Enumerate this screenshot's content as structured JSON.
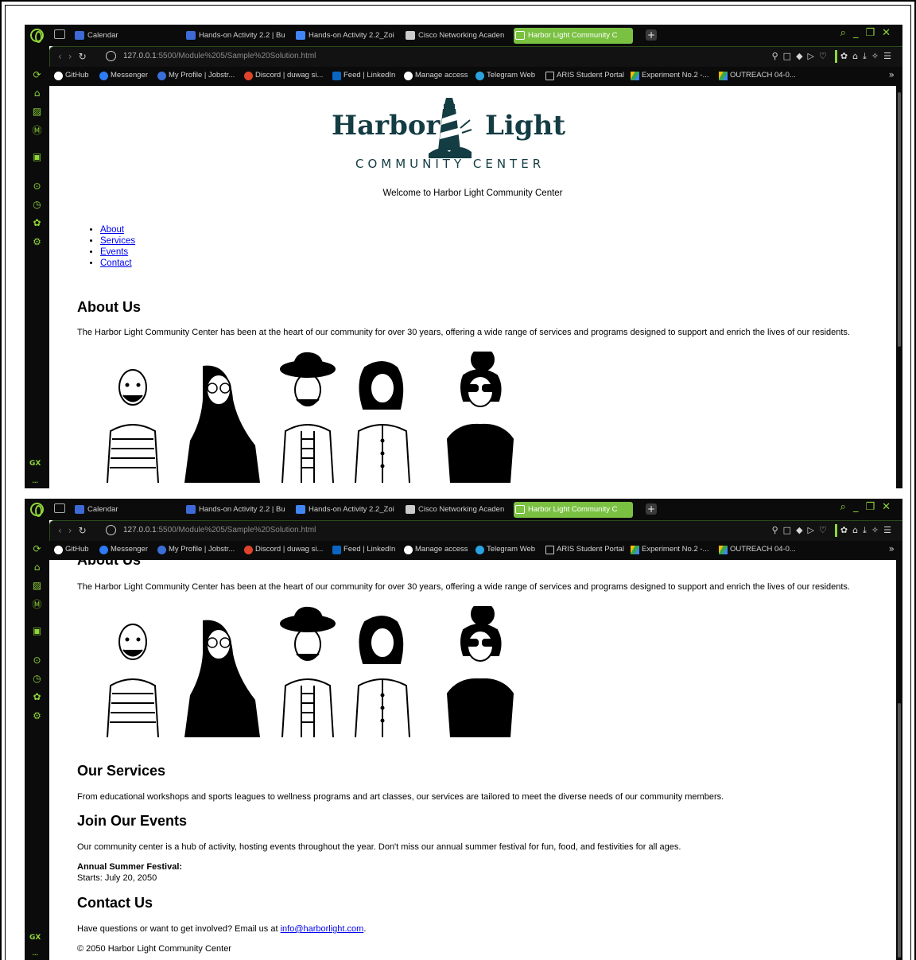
{
  "browser": {
    "tabs": [
      {
        "label": "Calendar",
        "icon": "calendar-icon"
      },
      {
        "label": "Hands-on Activity 2.2 | Bu",
        "icon": "document-icon"
      },
      {
        "label": "Hands-on Activity 2.2_Zoi",
        "icon": "docs-icon"
      },
      {
        "label": "Cisco Networking Acaden",
        "icon": "cisco-icon"
      },
      {
        "label": "Harbor Light Community C",
        "icon": "page-icon",
        "active": true
      }
    ],
    "url_host": "127.0.0.1",
    "url_path": ":5500/Module%205/Sample%20Solution.html",
    "bookmarks": [
      {
        "label": "GitHub",
        "icon": "github-icon"
      },
      {
        "label": "Messenger",
        "icon": "messenger-icon"
      },
      {
        "label": "My Profile | Jobstr...",
        "icon": "profile-icon"
      },
      {
        "label": "Discord | duwag si...",
        "icon": "discord-icon"
      },
      {
        "label": "Feed | LinkedIn",
        "icon": "linkedin-icon"
      },
      {
        "label": "Manage access",
        "icon": "github-icon"
      },
      {
        "label": "Telegram Web",
        "icon": "telegram-icon"
      },
      {
        "label": "ARIS Student Portal",
        "icon": "page-icon"
      },
      {
        "label": "Experiment No.2 -...",
        "icon": "drive-icon"
      },
      {
        "label": "OUTREACH 04-0...",
        "icon": "drive-icon"
      }
    ],
    "sidebar_gx": "GX",
    "sidebar_more": "...",
    "accent_color": "#8fd63a"
  },
  "site": {
    "logo_left": "Harbor",
    "logo_right": "Light",
    "logo_sub": "COMMUNITY CENTER",
    "welcome": "Welcome to Harbor Light Community Center",
    "nav": [
      "About",
      "Services",
      "Events",
      "Contact"
    ],
    "about_title": "About Us",
    "about_text": "The Harbor Light Community Center has been at the heart of our community for over 30 years, offering a wide range of services and programs designed to support and enrich the lives of our residents.",
    "services_title": "Our Services",
    "services_text": "From educational workshops and sports leagues to wellness programs and art classes, our services are tailored to meet the diverse needs of our community members.",
    "events_title": "Join Our Events",
    "events_text": "Our community center is a hub of activity, hosting events throughout the year. Don't miss our annual summer festival for fun, food, and festivities for all ages.",
    "festival_name": "Annual Summer Festival:",
    "festival_date": "Starts: July 20, 2050",
    "contact_title": "Contact Us",
    "contact_text": "Have questions or want to get involved? Email us at ",
    "contact_email": "info@harborlight.com",
    "contact_end": ".",
    "footer": "© 2050 Harbor Light Community Center",
    "brand_color": "#133c43"
  }
}
